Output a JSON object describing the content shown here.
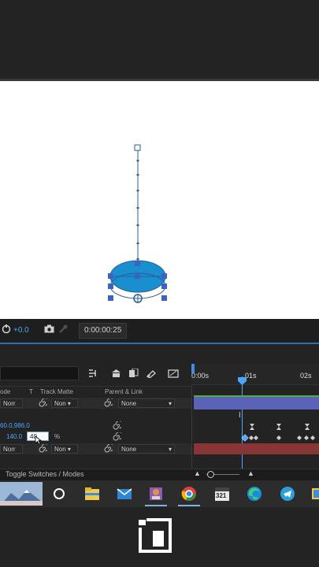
{
  "viewer_controls": {
    "exposure": "+0.0",
    "timecode": "0:00:00:25"
  },
  "timeline": {
    "ruler": {
      "t0": "0:00s",
      "t1": "01s",
      "t2": "02s"
    },
    "columns": {
      "mode": "ode",
      "t": "T",
      "track_matte": "Track Matte",
      "parent": "Parent & Link"
    },
    "layer1": {
      "mode": "Norr",
      "matte": "Non",
      "parent": "None"
    },
    "position_value": "60.0,986.0",
    "scale_value_left": "140.0",
    "scale_value_editing": "40",
    "scale_unit": "%",
    "layer2": {
      "mode": "Norr",
      "matte": "Non",
      "parent": "None"
    },
    "toggle_label": "Toggle Switches / Modes"
  },
  "taskbar": {
    "calendar_badge": "321"
  }
}
